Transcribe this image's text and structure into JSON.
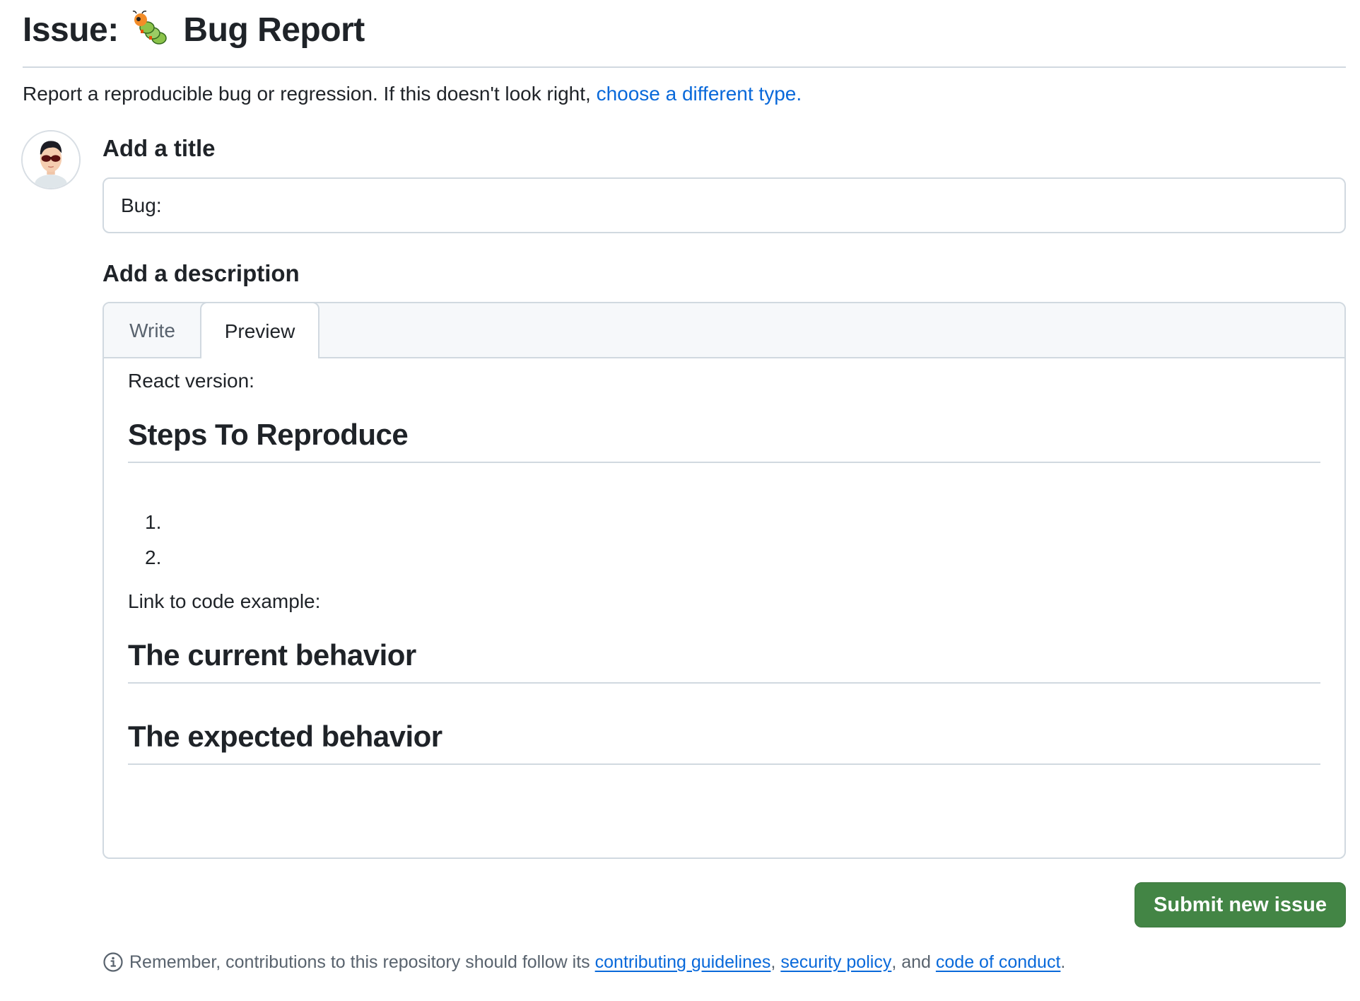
{
  "header": {
    "title_prefix": "Issue:",
    "title_icon": "caterpillar-bug-emoji",
    "title_text": "Bug Report",
    "subtitle_text": "Report a reproducible bug or regression. If this doesn't look right, ",
    "subtitle_link": "choose a different type."
  },
  "user": {
    "avatar": "user-avatar"
  },
  "form": {
    "title_label": "Add a title",
    "title_value": "Bug: ",
    "description_label": "Add a description",
    "tabs": [
      {
        "label": "Write",
        "active": false
      },
      {
        "label": "Preview",
        "active": true
      }
    ],
    "preview": {
      "react_version": "React version:",
      "steps_heading": "Steps To Reproduce",
      "steps": [
        "1.",
        "2."
      ],
      "link_to_code": "Link to code example:",
      "current_behavior_heading": "The current behavior",
      "expected_behavior_heading": "The expected behavior"
    },
    "submit_label": "Submit new issue"
  },
  "footer": {
    "icon": "info-icon",
    "text_before": "Remember, contributions to this repository should follow its ",
    "link_contributing": "contributing guidelines",
    "sep1": ",",
    "link_security": "security policy",
    "sep2": ", and ",
    "link_conduct": "code of conduct",
    "end": "."
  },
  "colors": {
    "accent_link": "#0969da",
    "submit_green": "#438545",
    "border": "#d1d9e0",
    "tab_strip_bg": "#f6f8fa",
    "text_primary": "#1f2328",
    "text_muted": "#59636e"
  }
}
